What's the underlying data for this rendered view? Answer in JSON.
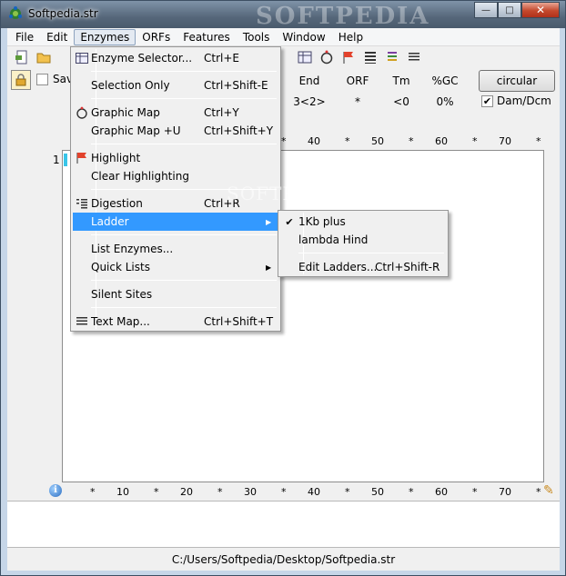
{
  "window": {
    "title": "Softpedia.str",
    "watermark": "SOFTPEDIA",
    "buttons": {
      "minimize": "—",
      "maximize": "□",
      "close": "✕"
    }
  },
  "menubar": [
    "File",
    "Edit",
    "Enzymes",
    "ORFs",
    "Features",
    "Tools",
    "Window",
    "Help"
  ],
  "toolbar_icons": [
    "new-doc-icon",
    "open-folder-icon",
    "save-icon",
    "grid-icon",
    "enzyme-ring-icon",
    "flag-icon",
    "text-map-icon",
    "ladder-icon",
    "list-icon"
  ],
  "info": {
    "save_label": "Sav",
    "columns": [
      {
        "header": "End",
        "value": "3<2>"
      },
      {
        "header": "ORF",
        "value": "*"
      },
      {
        "header": "Tm",
        "value": "<0"
      },
      {
        "header": "%GC",
        "value": "0%"
      }
    ],
    "circular_label": "circular",
    "dam_label": "Dam/Dcm",
    "dam_checked": "✔"
  },
  "ruler_top": [
    "*",
    "40",
    "*",
    "50",
    "*",
    "60",
    "*",
    "70",
    "*"
  ],
  "ruler_bottom": [
    "*",
    "10",
    "*",
    "20",
    "*",
    "30",
    "*",
    "40",
    "*",
    "50",
    "*",
    "60",
    "*",
    "70",
    "*"
  ],
  "sequence": {
    "row_number": "1"
  },
  "enzymes_menu": [
    {
      "label": "Enzyme Selector...",
      "shortcut": "Ctrl+E",
      "icon": "enzyme-selector-icon"
    },
    {
      "sep": true
    },
    {
      "label": "Selection Only",
      "shortcut": "Ctrl+Shift-E"
    },
    {
      "sep": true
    },
    {
      "label": "Graphic Map",
      "shortcut": "Ctrl+Y",
      "icon": "graphic-map-icon"
    },
    {
      "label": "Graphic Map +U",
      "shortcut": "Ctrl+Shift+Y"
    },
    {
      "sep": true
    },
    {
      "label": "Highlight",
      "shortcut": "",
      "icon": "highlight-flag-icon"
    },
    {
      "label": "Clear Highlighting",
      "shortcut": ""
    },
    {
      "sep": true
    },
    {
      "label": "Digestion",
      "shortcut": "Ctrl+R",
      "icon": "digestion-icon"
    },
    {
      "label": "Ladder",
      "shortcut": "",
      "submenu": true,
      "highlighted": true
    },
    {
      "sep": true
    },
    {
      "label": "List Enzymes...",
      "shortcut": ""
    },
    {
      "label": "Quick Lists",
      "shortcut": "",
      "submenu": true
    },
    {
      "sep": true
    },
    {
      "label": "Silent Sites",
      "shortcut": ""
    },
    {
      "sep": true
    },
    {
      "label": "Text Map...",
      "shortcut": "Ctrl+Shift+T",
      "icon": "text-map-icon"
    }
  ],
  "ladder_submenu": [
    {
      "label": "1Kb plus",
      "checked": true,
      "shortcut": ""
    },
    {
      "label": "lambda Hind",
      "checked": false,
      "shortcut": ""
    },
    {
      "sep": true
    },
    {
      "label": "Edit Ladders...",
      "checked": false,
      "shortcut": "Ctrl+Shift-R"
    }
  ],
  "status": {
    "path": "C:/Users/Softpedia/Desktop/Softpedia.str"
  }
}
